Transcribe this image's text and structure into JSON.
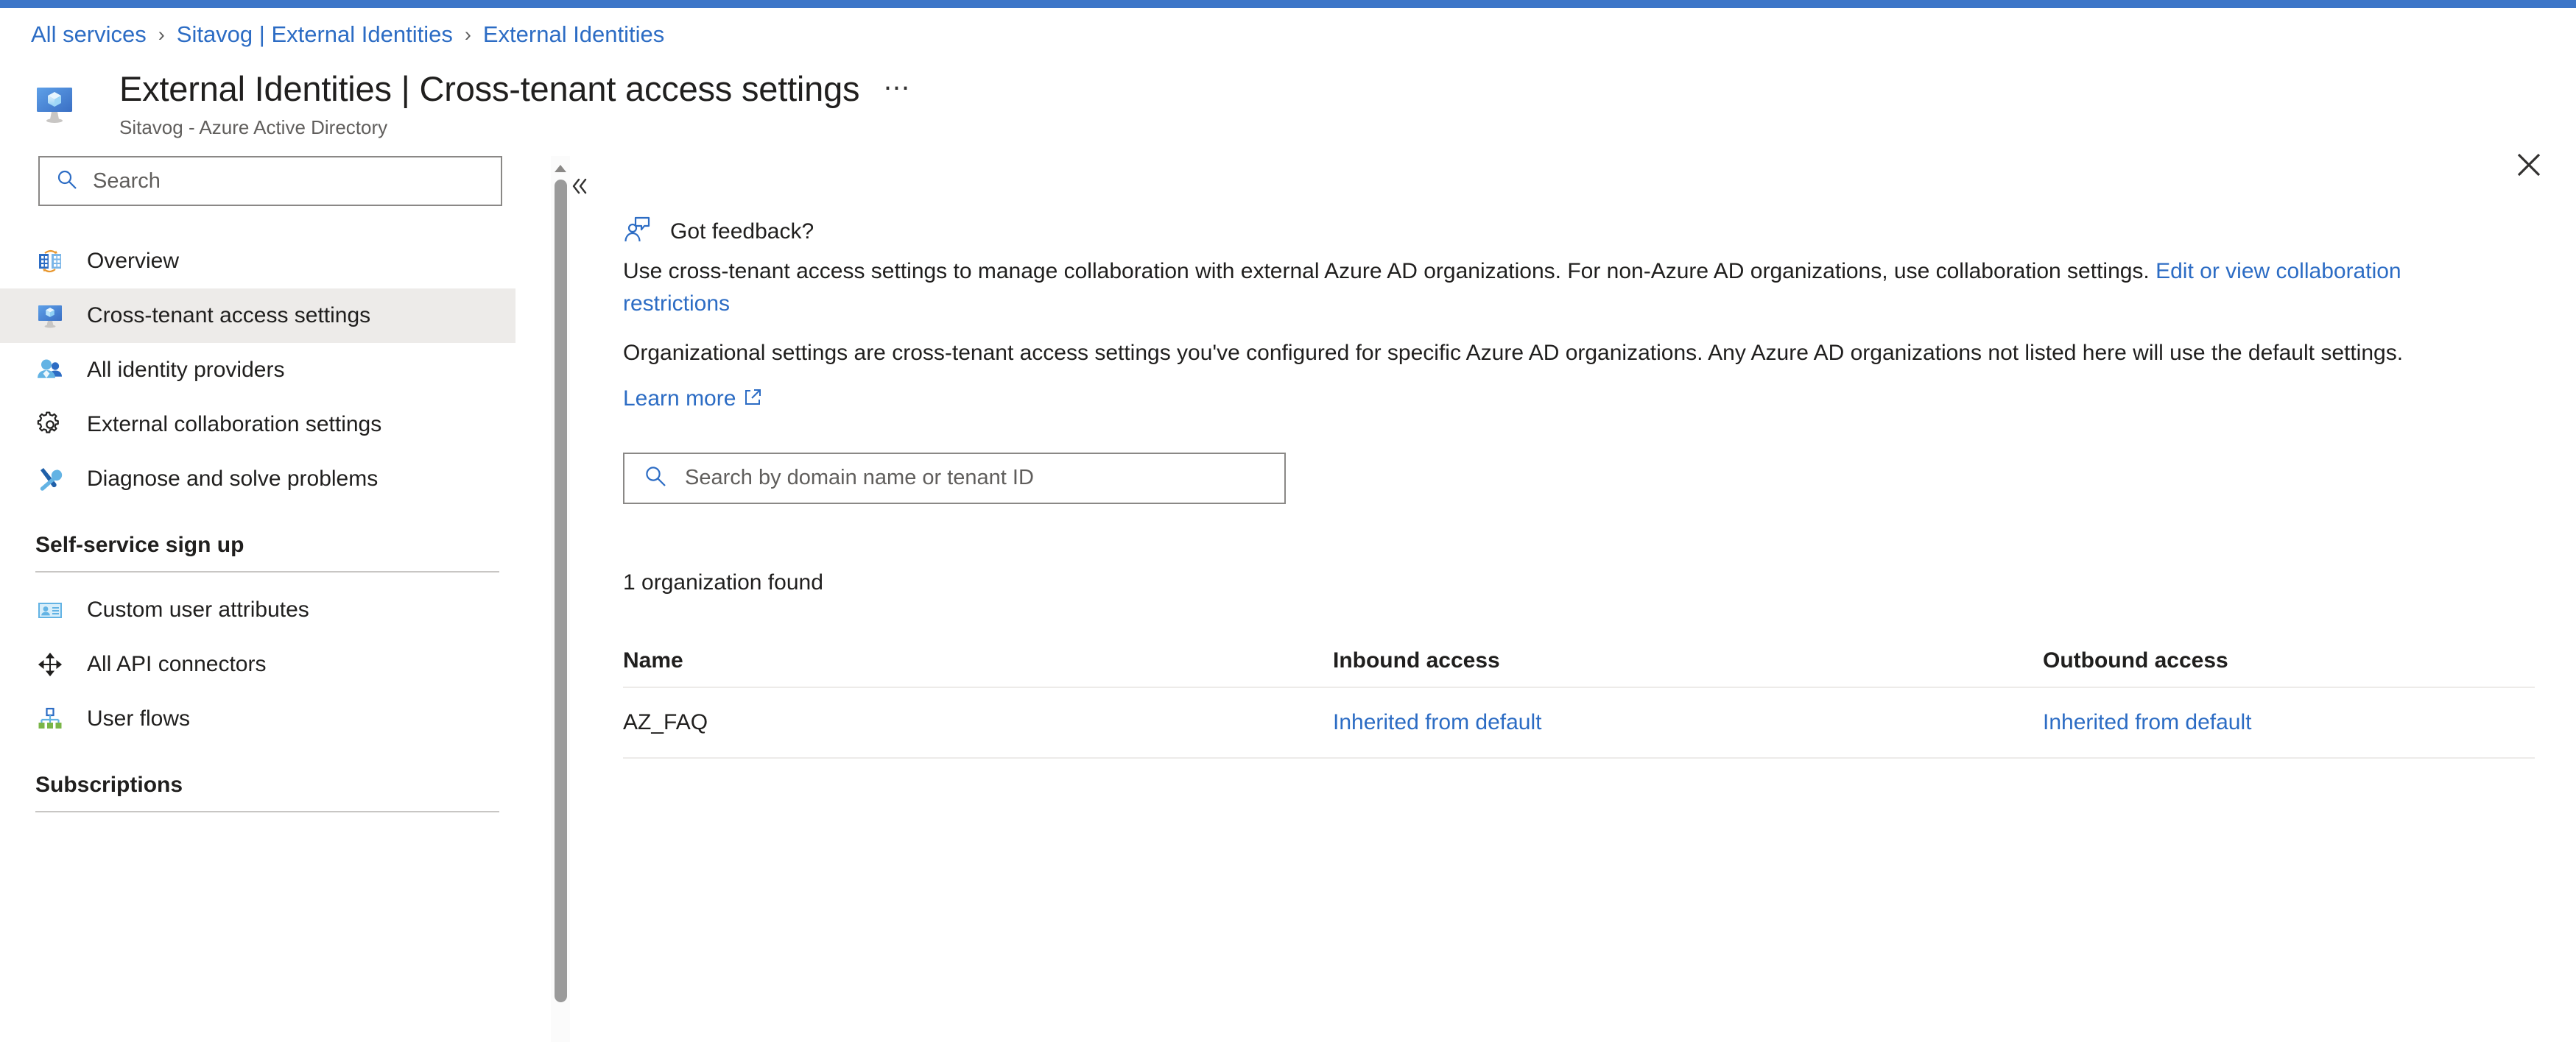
{
  "theme": {
    "accent_bar": "#3d76c8",
    "link": "#2c6cc4",
    "selected_row": "#edebe9",
    "text": "#201f1e",
    "muted_text": "#605e5c",
    "border": "#8a8886"
  },
  "breadcrumb": {
    "items": [
      {
        "label": "All services"
      },
      {
        "label": "Sitavog | External Identities"
      },
      {
        "label": "External Identities"
      }
    ],
    "separator": "›"
  },
  "header": {
    "icon": "external-identities-resource-icon",
    "title": "External Identities | Cross-tenant access settings",
    "subtitle": "Sitavog - Azure Active Directory",
    "more_label": "⋯",
    "close_label": "close-icon"
  },
  "sidebar": {
    "search": {
      "placeholder": "Search",
      "value": "",
      "icon": "search-icon"
    },
    "collapse": {
      "icon": "chevron-double-left-icon",
      "label": "«"
    },
    "items": [
      {
        "label": "Overview",
        "icon": "overview-icon",
        "selected": false
      },
      {
        "label": "Cross-tenant access settings",
        "icon": "cross-tenant-icon",
        "selected": true
      },
      {
        "label": "All identity providers",
        "icon": "identity-providers-icon",
        "selected": false
      },
      {
        "label": "External collaboration settings",
        "icon": "gear-icon",
        "selected": false
      },
      {
        "label": "Diagnose and solve problems",
        "icon": "wrench-screwdriver-icon",
        "selected": false
      }
    ],
    "sections": [
      {
        "title": "Self-service sign up",
        "items": [
          {
            "label": "Custom user attributes",
            "icon": "user-attributes-icon"
          },
          {
            "label": "All API connectors",
            "icon": "api-connectors-icon"
          },
          {
            "label": "User flows",
            "icon": "user-flows-icon"
          }
        ]
      },
      {
        "title": "Subscriptions",
        "items": []
      }
    ]
  },
  "main": {
    "feedback": {
      "label": "Got feedback?",
      "icon": "feedback-person-icon"
    },
    "intro_paragraph_1_part1": "Use cross-tenant access settings to manage collaboration with external Azure AD organizations. For non-Azure AD organizations, use collaboration settings. ",
    "intro_paragraph_1_link": "Edit or view collaboration restrictions",
    "intro_paragraph_2": "Organizational settings are cross-tenant access settings you've configured for specific Azure AD organizations. Any Azure AD organizations not listed here will use the default settings.",
    "learn_more": "Learn more",
    "learn_more_icon": "external-link-icon",
    "search": {
      "placeholder": "Search by domain name or tenant ID",
      "value": "",
      "icon": "search-icon"
    },
    "result_count": "1 organization found",
    "table": {
      "columns": [
        "Name",
        "Inbound access",
        "Outbound access"
      ],
      "rows": [
        {
          "name": "AZ_FAQ",
          "inbound": "Inherited from default",
          "outbound": "Inherited from default"
        }
      ]
    }
  },
  "scrollbar": {
    "up_arrow": "scroll-up-arrow-icon",
    "thumb": "scroll-thumb"
  }
}
